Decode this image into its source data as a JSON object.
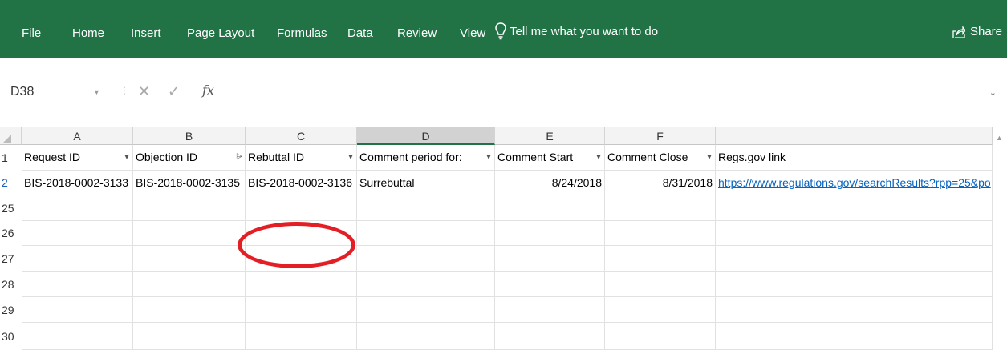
{
  "ribbon": {
    "tabs": [
      "File",
      "Home",
      "Insert",
      "Page Layout",
      "Formulas",
      "Data",
      "Review",
      "View"
    ],
    "tell_me": "Tell me what you want to do",
    "share": "Share",
    "bg_color": "#217346"
  },
  "formula_bar": {
    "name_box": "D38",
    "cancel_icon": "✕",
    "enter_icon": "✓",
    "fx_icon": "fx",
    "formula": ""
  },
  "grid": {
    "columns": [
      "A",
      "B",
      "C",
      "D",
      "E",
      "F"
    ],
    "selected_column": "D",
    "rows": [
      {
        "num": "1",
        "cells": [
          "Request ID",
          "Objection ID",
          "Rebuttal ID",
          "Comment period for:",
          "Comment Start",
          "Comment Close",
          "Regs.gov link"
        ]
      },
      {
        "num": "2",
        "cells": [
          "BIS-2018-0002-3133",
          "BIS-2018-0002-3135",
          "BIS-2018-0002-3136",
          "Surrebuttal",
          "8/24/2018",
          "8/31/2018",
          "https://www.regulations.gov/searchResults?rpp=25&po"
        ]
      },
      {
        "num": "25",
        "cells": []
      },
      {
        "num": "26",
        "cells": []
      },
      {
        "num": "27",
        "cells": []
      },
      {
        "num": "28",
        "cells": []
      },
      {
        "num": "29",
        "cells": []
      },
      {
        "num": "30",
        "cells": []
      }
    ],
    "filter_icons": [
      "dropdown-icon",
      "filter-applied-icon",
      "dropdown-icon",
      "dropdown-icon",
      "dropdown-icon",
      "dropdown-icon"
    ],
    "link_color": "#0563c1",
    "annotation_color": "#e31e24"
  }
}
